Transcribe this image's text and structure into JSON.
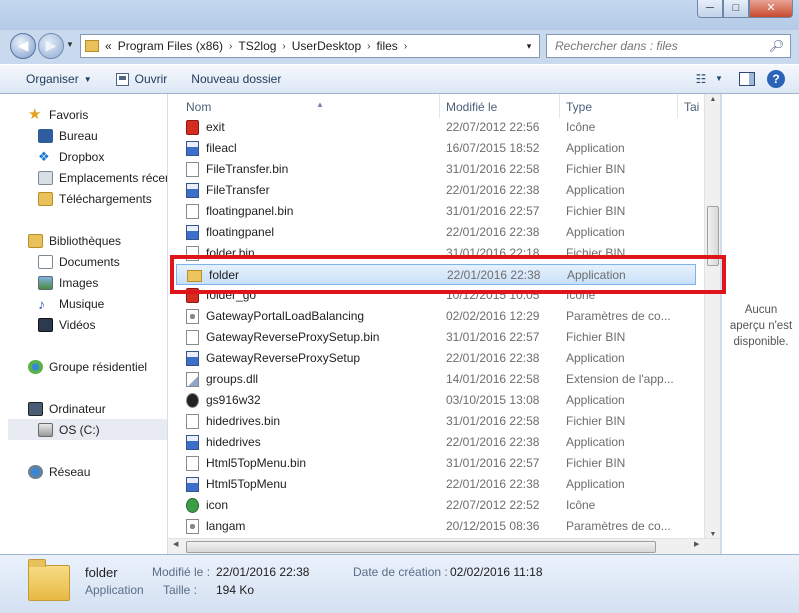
{
  "window": {
    "minimize": "─",
    "maximize": "□",
    "close": "✕"
  },
  "address": {
    "overflow": "«",
    "crumbs": [
      "Program Files (x86)",
      "TS2log",
      "UserDesktop",
      "files"
    ],
    "separator": "›",
    "dropdown": "▾"
  },
  "search": {
    "placeholder": "Rechercher dans : files",
    "icon": "search-icon"
  },
  "toolbar": {
    "organiser": "Organiser",
    "ouvrir": "Ouvrir",
    "nouveau_dossier": "Nouveau dossier",
    "help": "?"
  },
  "nav": {
    "favoris": "Favoris",
    "bureau": "Bureau",
    "dropbox": "Dropbox",
    "emplacements": "Emplacements récents",
    "telechargements": "Téléchargements",
    "bibliotheques": "Bibliothèques",
    "documents": "Documents",
    "images": "Images",
    "musique": "Musique",
    "videos": "Vidéos",
    "groupe": "Groupe résidentiel",
    "ordinateur": "Ordinateur",
    "os": "OS (C:)",
    "reseau": "Réseau"
  },
  "columns": {
    "name": "Nom",
    "modified": "Modifié le",
    "type": "Type",
    "size": "Tai"
  },
  "files": [
    {
      "name": "exit",
      "date": "22/07/2012 22:56",
      "type": "Icône",
      "icon": "red"
    },
    {
      "name": "fileacl",
      "date": "16/07/2015 18:52",
      "type": "Application",
      "icon": "app"
    },
    {
      "name": "FileTransfer.bin",
      "date": "31/01/2016 22:58",
      "type": "Fichier BIN",
      "icon": "bin"
    },
    {
      "name": "FileTransfer",
      "date": "22/01/2016 22:38",
      "type": "Application",
      "icon": "app"
    },
    {
      "name": "floatingpanel.bin",
      "date": "31/01/2016 22:57",
      "type": "Fichier BIN",
      "icon": "bin"
    },
    {
      "name": "floatingpanel",
      "date": "22/01/2016 22:38",
      "type": "Application",
      "icon": "app"
    },
    {
      "name": "folder.bin",
      "date": "31/01/2016 22:18",
      "type": "Fichier BIN",
      "icon": "bin"
    },
    {
      "name": "folder",
      "date": "22/01/2016 22:38",
      "type": "Application",
      "icon": "folder"
    },
    {
      "name": "folder_go",
      "date": "10/12/2015 10:05",
      "type": "Icône",
      "icon": "red"
    },
    {
      "name": "GatewayPortalLoadBalancing",
      "date": "02/02/2016 12:29",
      "type": "Paramètres de co...",
      "icon": "cfg"
    },
    {
      "name": "GatewayReverseProxySetup.bin",
      "date": "31/01/2016 22:57",
      "type": "Fichier BIN",
      "icon": "bin"
    },
    {
      "name": "GatewayReverseProxySetup",
      "date": "22/01/2016 22:38",
      "type": "Application",
      "icon": "app"
    },
    {
      "name": "groups.dll",
      "date": "14/01/2016 22:58",
      "type": "Extension de l'app...",
      "icon": "dll"
    },
    {
      "name": "gs916w32",
      "date": "03/10/2015 13:08",
      "type": "Application",
      "icon": "gs"
    },
    {
      "name": "hidedrives.bin",
      "date": "31/01/2016 22:58",
      "type": "Fichier BIN",
      "icon": "bin"
    },
    {
      "name": "hidedrives",
      "date": "22/01/2016 22:38",
      "type": "Application",
      "icon": "app"
    },
    {
      "name": "Html5TopMenu.bin",
      "date": "31/01/2016 22:57",
      "type": "Fichier BIN",
      "icon": "bin"
    },
    {
      "name": "Html5TopMenu",
      "date": "22/01/2016 22:38",
      "type": "Application",
      "icon": "app"
    },
    {
      "name": "icon",
      "date": "22/07/2012 22:52",
      "type": "Icône",
      "icon": "icon"
    },
    {
      "name": "langam",
      "date": "20/12/2015 08:36",
      "type": "Paramètres de co...",
      "icon": "cfg"
    }
  ],
  "preview": {
    "line1": "Aucun",
    "line2": "aperçu n'est",
    "line3": "disponible."
  },
  "details": {
    "name": "folder",
    "type": "Application",
    "modified_label": "Modifié le :",
    "modified_value": "22/01/2016 22:38",
    "size_label": "Taille :",
    "size_value": "194 Ko",
    "created_label": "Date de création :",
    "created_value": "02/02/2016 11:18"
  }
}
